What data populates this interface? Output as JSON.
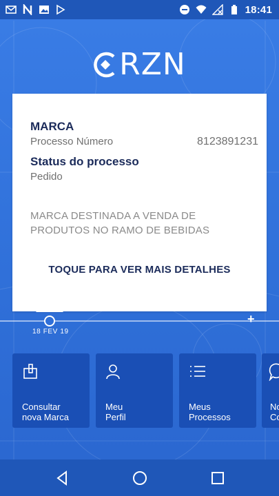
{
  "status_bar": {
    "time": "18:41",
    "left_icons": [
      "gmail-icon",
      "n-app-icon",
      "image-icon",
      "play-store-icon"
    ],
    "right_icons": [
      "do-not-disturb-icon",
      "wifi-icon",
      "no-signal-icon",
      "battery-icon"
    ]
  },
  "logo": {
    "text": "RZN"
  },
  "card": {
    "title": "MARCA",
    "process_label": "Processo Número",
    "process_number": "8123891231",
    "status_title": "Status do processo",
    "status_value": "Pedido",
    "description": "MARCA DESTINADA A VENDA DE PRODUTOS NO RAMO DE BEBIDAS",
    "cta": "TOQUE PARA VER MAIS DETALHES"
  },
  "timeline": {
    "date": "18 FEV 19",
    "add_symbol": "+"
  },
  "tiles": [
    {
      "label_line1": "Consultar",
      "label_line2": "nova Marca",
      "icon": "document-hand-icon"
    },
    {
      "label_line1": "Meu",
      "label_line2": "Perfil",
      "icon": "person-icon"
    },
    {
      "label_line1": "Meus",
      "label_line2": "Processos",
      "icon": "list-icon"
    },
    {
      "label_line1": "No",
      "label_line2": "Co",
      "icon": "chat-icon"
    }
  ],
  "colors": {
    "primary": "#2f6fd8",
    "tile": "#1a4fb5",
    "bar": "#1f57b8",
    "title_text": "#1b2b5a"
  }
}
